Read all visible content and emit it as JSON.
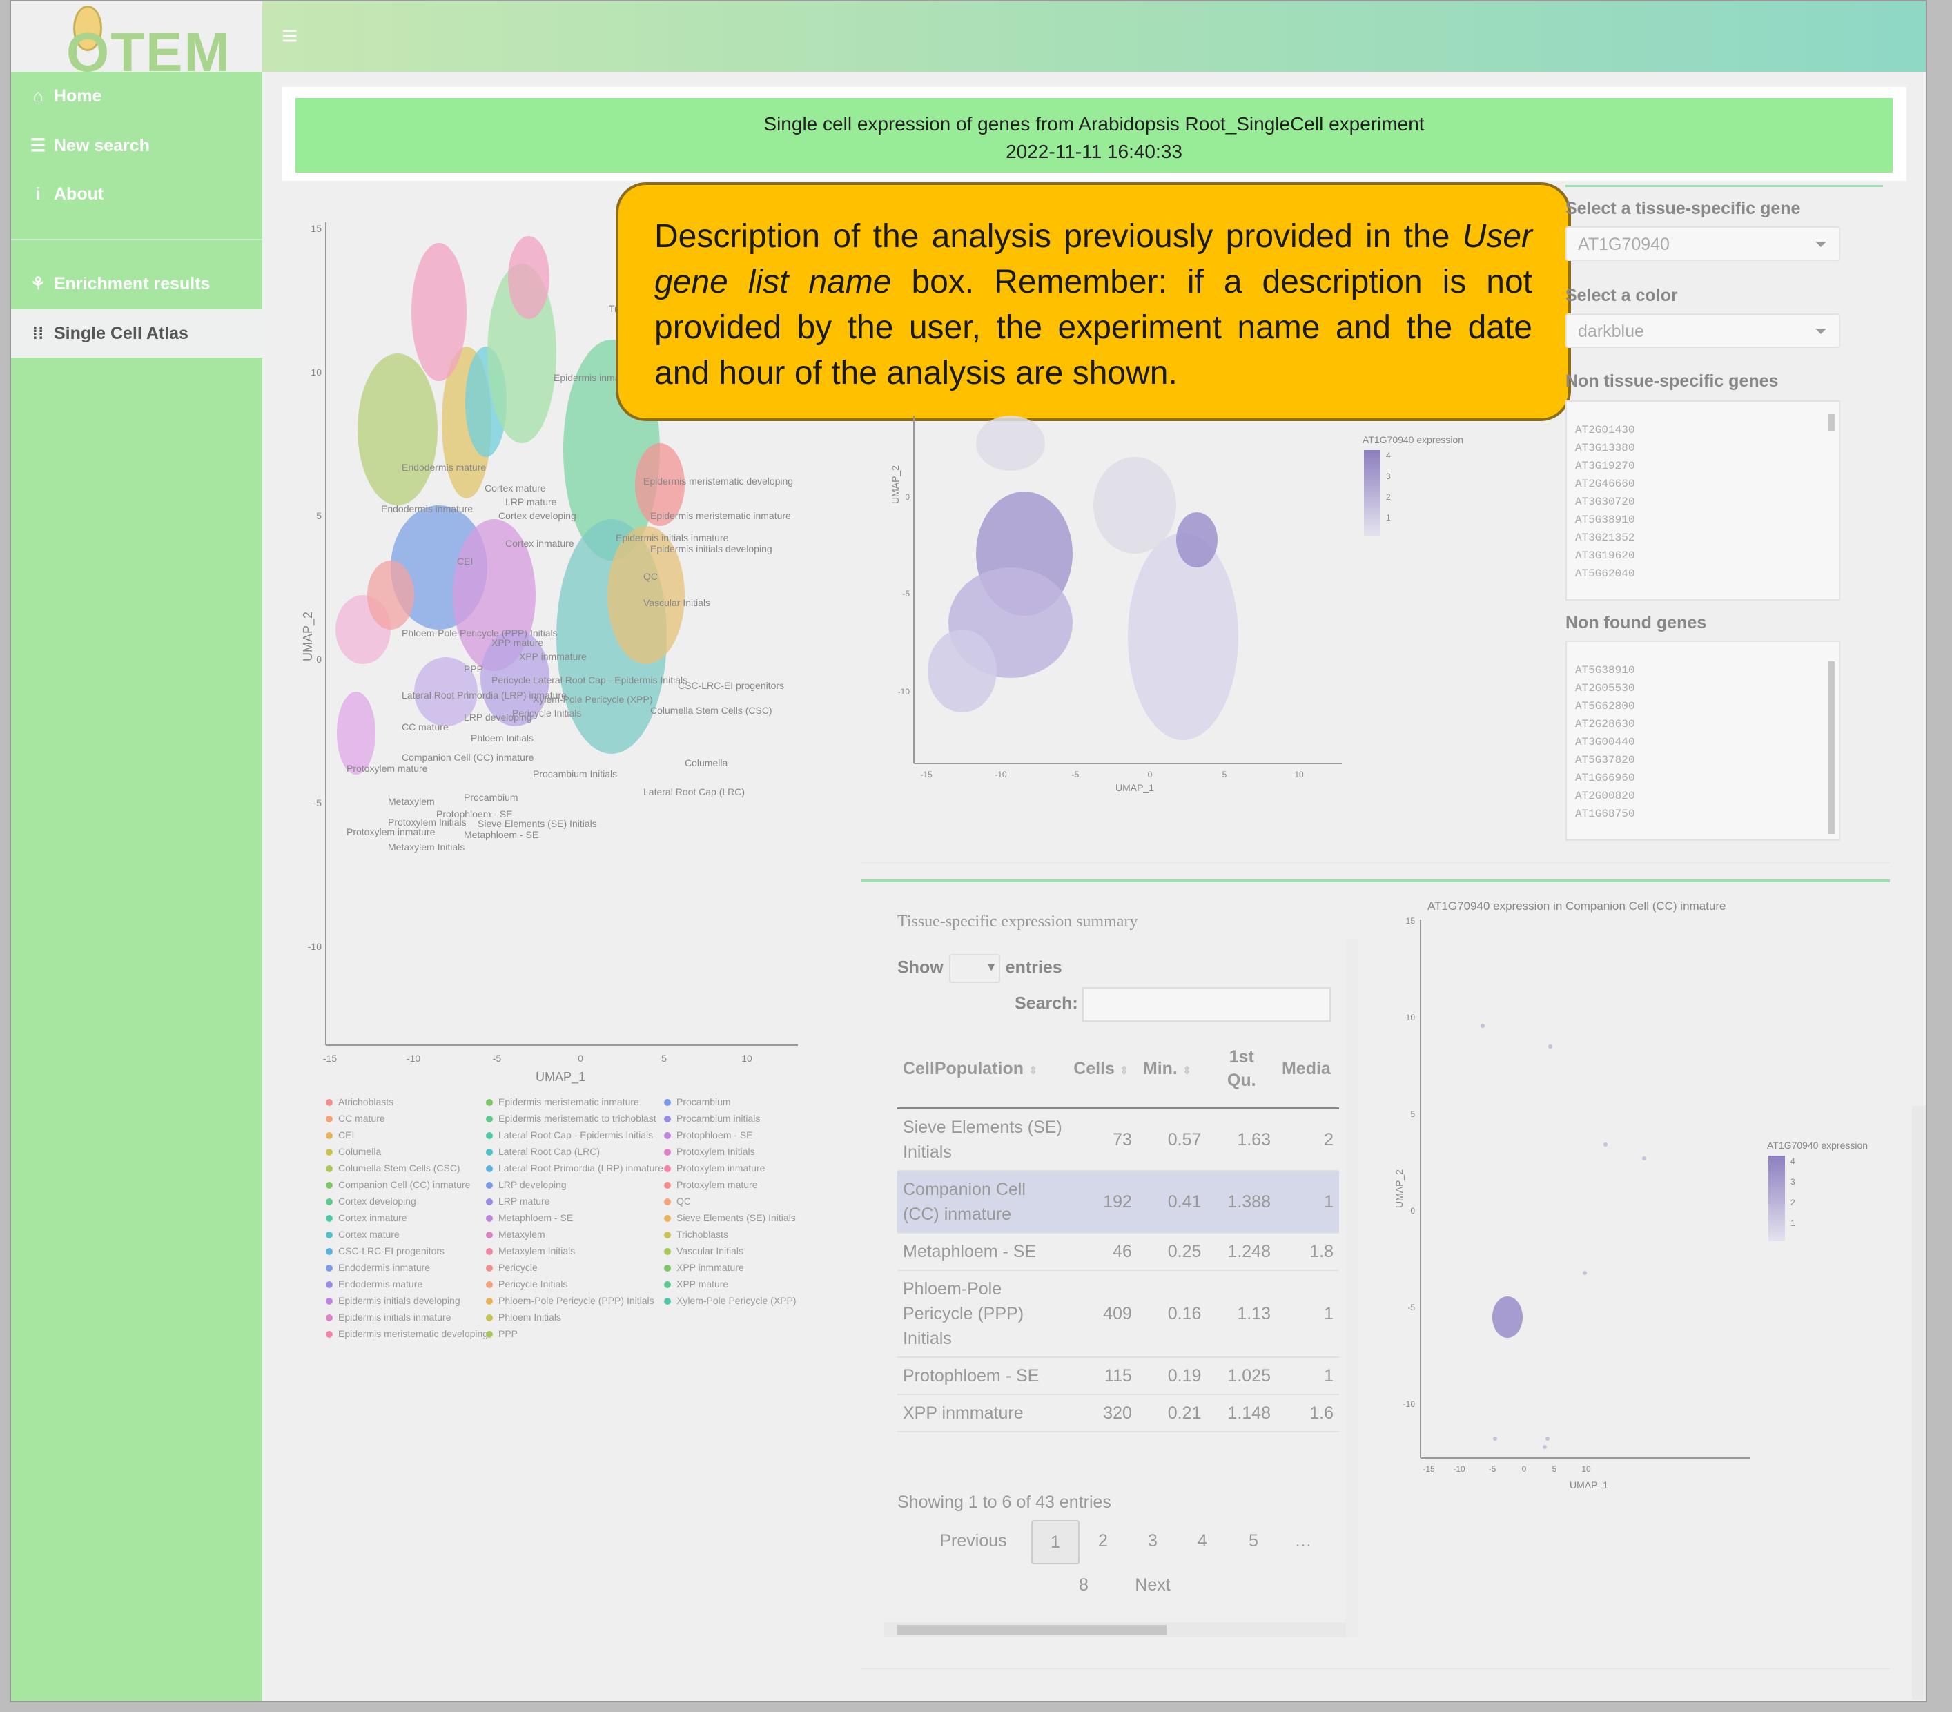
{
  "app": {
    "logo_text": "OTEM",
    "menu_icon": "hamburger-icon"
  },
  "sidebar": {
    "items": [
      {
        "label": "Home",
        "icon": "home-icon"
      },
      {
        "label": "New search",
        "icon": "database-icon"
      },
      {
        "label": "About",
        "icon": "info-icon"
      },
      {
        "label": "Enrichment results",
        "icon": "seedling-icon"
      },
      {
        "label": "Single Cell Atlas",
        "icon": "grid-dots-icon"
      }
    ]
  },
  "banner": {
    "line1": "Single cell expression of genes from Arabidopsis Root_SingleCell experiment",
    "line2": "2022-11-11 16:40:33"
  },
  "callout": {
    "part1": "Description of the analysis previously provided in the ",
    "italic": "User gene list name",
    "part2": " box. Remember: if a description is not provided by the user, the experiment name and the date and hour of the analysis are shown."
  },
  "controls": {
    "gene_label": "Select a tissue-specific gene",
    "gene_value": "AT1G70940",
    "color_label": "Select a color",
    "color_value": "darkblue",
    "non_specific_label": "Non tissue-specific genes",
    "non_specific_genes": [
      "AT2G01430",
      "AT3G13380",
      "AT3G19270",
      "AT2G46660",
      "AT3G30720",
      "AT5G38910",
      "AT3G21352",
      "AT3G19620",
      "AT5G62040"
    ],
    "non_found_label": "Non found genes",
    "non_found_genes": [
      "AT5G38910",
      "AT2G05530",
      "AT5G62800",
      "AT2G28630",
      "AT3G00440",
      "AT5G37820",
      "AT1G66960",
      "AT2G00820",
      "AT1G68750"
    ]
  },
  "umap_main": {
    "xlabel": "UMAP_1",
    "ylabel": "UMAP_2",
    "xticks": [
      "-15",
      "-10",
      "-5",
      "0",
      "5",
      "10"
    ],
    "yticks": [
      "15",
      "10",
      "5",
      "0",
      "-5",
      "-10"
    ],
    "cluster_labels": [
      "Trichob",
      "Epidermis inmature",
      "Endodermis mature",
      "Cortex mature",
      "LRP mature",
      "Endodermis inmature",
      "Cortex developing",
      "Cortex inmature",
      "Epidermis meristematic developing",
      "Epidermis meristematic inmature",
      "Epidermis initials inmature",
      "Epidermis initials developing",
      "CEI",
      "QC",
      "Vascular Initials",
      "Phloem-Pole Pericycle (PPP) Initials",
      "XPP mature",
      "XPP inmmature",
      "PPP",
      "Pericycle",
      "Lateral Root Cap - Epidermis Initials",
      "CSC-LRC-EI progenitors",
      "Lateral Root Primordia (LRP) inmature",
      "Xylem-Pole Pericycle (XPP)",
      "Pericycle Initials",
      "Columella Stem Cells (CSC)",
      "LRP developing",
      "CC mature",
      "Phloem Initials",
      "Companion Cell (CC) inmature",
      "Protoxylem mature",
      "Procambium Initials",
      "Columella",
      "Lateral Root Cap (LRC)",
      "Procambium",
      "Metaxylem",
      "Protophloem - SE",
      "Protoxylem Initials",
      "Sieve Elements (SE) Initials",
      "Protoxylem inmature",
      "Metaphloem - SE",
      "Metaxylem Initials"
    ]
  },
  "legend": {
    "col1": [
      "Atrichoblasts",
      "CC mature",
      "CEI",
      "Columella",
      "Columella Stem Cells (CSC)",
      "Companion Cell (CC) inmature",
      "Cortex developing",
      "Cortex inmature",
      "Cortex mature",
      "CSC-LRC-EI progenitors",
      "Endodermis inmature",
      "Endodermis mature",
      "Epidermis initials developing",
      "Epidermis initials inmature",
      "Epidermis meristematic developing"
    ],
    "col2": [
      "Epidermis meristematic inmature",
      "Epidermis meristematic to trichoblast",
      "Lateral Root Cap - Epidermis Initials",
      "Lateral Root Cap (LRC)",
      "Lateral Root Primordia (LRP) inmature",
      "LRP developing",
      "LRP mature",
      "Metaphloem - SE",
      "Metaxylem",
      "Metaxylem Initials",
      "Pericycle",
      "Pericycle Initials",
      "Phloem-Pole Pericycle (PPP) Initials",
      "Phloem Initials",
      "PPP"
    ],
    "col3": [
      "Procambium",
      "Procambium initials",
      "Protophloem - SE",
      "Protoxylem Initials",
      "Protoxylem inmature",
      "Protoxylem mature",
      "QC",
      "Sieve Elements (SE) Initials",
      "Trichoblasts",
      "Vascular Initials",
      "XPP inmmature",
      "XPP mature",
      "Xylem-Pole Pericycle (XPP)"
    ],
    "colors": [
      "#f28e8e",
      "#f6a27a",
      "#e8b35a",
      "#c9c353",
      "#a9c85a",
      "#7dc66a",
      "#5ec98a",
      "#52c7a8",
      "#4fc2c6",
      "#5ab3dd",
      "#7a9ce6",
      "#9c8be6",
      "#bf84dd",
      "#dd82c6",
      "#f285a6"
    ]
  },
  "umap_expr": {
    "legend_title": "AT1G70940 expression",
    "legend_ticks": [
      "4",
      "3",
      "2",
      "1"
    ],
    "xlabel": "UMAP_1",
    "ylabel": "UMAP_2",
    "xticks": [
      "-15",
      "-10",
      "-5",
      "0",
      "5",
      "10"
    ],
    "yticks": [
      "0",
      "-5",
      "-10"
    ]
  },
  "umap_tissue": {
    "title": "AT1G70940 expression in Companion Cell (CC) inmature",
    "legend_title": "AT1G70940 expression",
    "legend_ticks": [
      "4",
      "3",
      "2",
      "1"
    ],
    "xlabel": "UMAP_1",
    "ylabel": "UMAP_2",
    "xticks": [
      "-15",
      "-10",
      "-5",
      "0",
      "5",
      "10"
    ],
    "yticks": [
      "15",
      "10",
      "5",
      "0",
      "-5",
      "-10"
    ]
  },
  "summary": {
    "title": "Tissue-specific expression summary",
    "show_label": "Show",
    "entries_label": "entries",
    "search_label": "Search:",
    "columns": [
      "CellPopulation",
      "Cells",
      "Min.",
      "1st Qu.",
      "Media"
    ],
    "rows": [
      {
        "pop": "Sieve Elements (SE) Initials",
        "cells": "73",
        "min": "0.57",
        "q1": "1.63",
        "med": "2"
      },
      {
        "pop": "Companion Cell (CC) inmature",
        "cells": "192",
        "min": "0.41",
        "q1": "1.388",
        "med": "1"
      },
      {
        "pop": "Metaphloem - SE",
        "cells": "46",
        "min": "0.25",
        "q1": "1.248",
        "med": "1.8"
      },
      {
        "pop": "Phloem-Pole Pericycle (PPP) Initials",
        "cells": "409",
        "min": "0.16",
        "q1": "1.13",
        "med": "1"
      },
      {
        "pop": "Protophloem - SE",
        "cells": "115",
        "min": "0.19",
        "q1": "1.025",
        "med": "1"
      },
      {
        "pop": "XPP inmmature",
        "cells": "320",
        "min": "0.21",
        "q1": "1.148",
        "med": "1.6"
      }
    ],
    "info": "Showing 1 to 6 of 43 entries",
    "previous": "Previous",
    "pages": [
      "1",
      "2",
      "3",
      "4",
      "5",
      "…",
      "8"
    ],
    "next": "Next"
  }
}
